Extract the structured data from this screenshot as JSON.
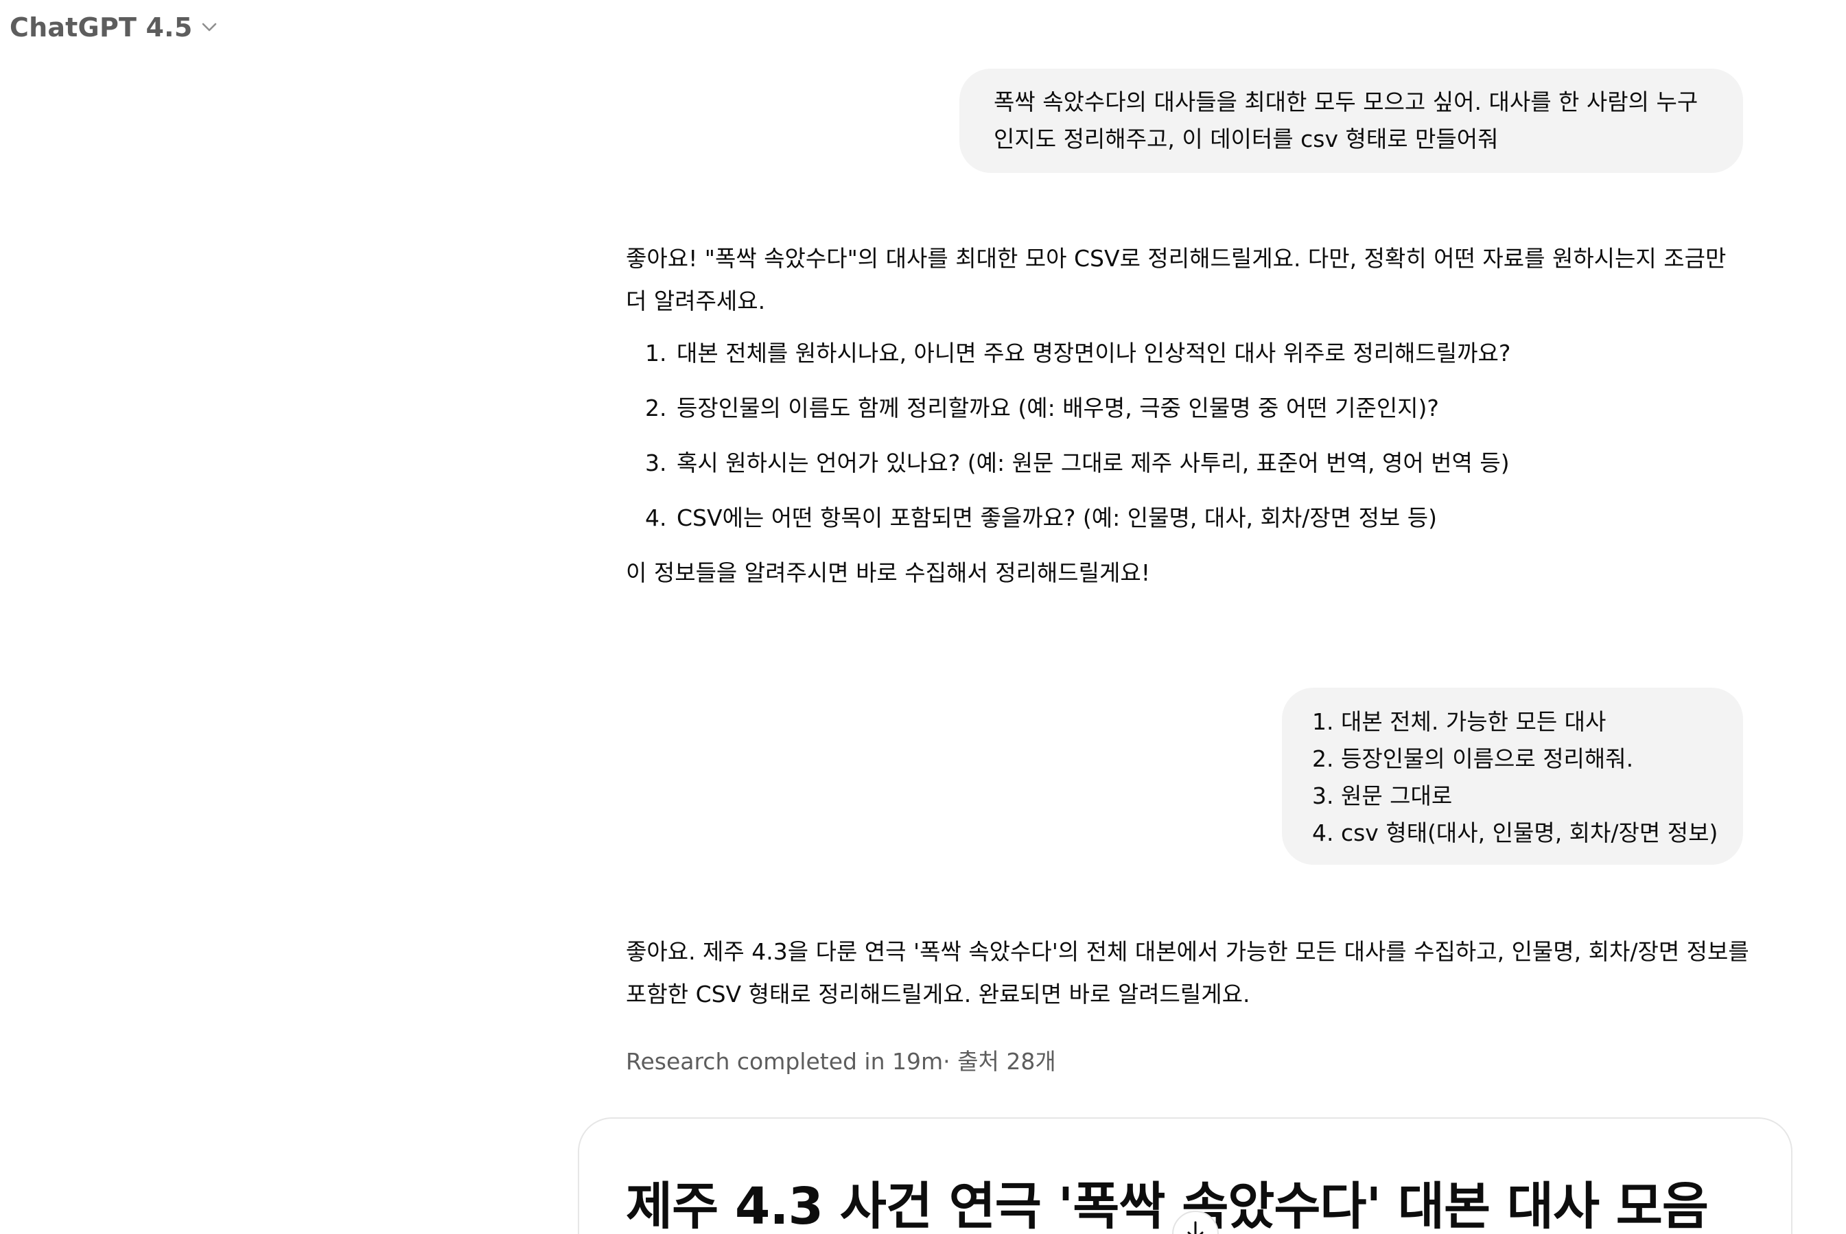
{
  "header": {
    "model_label": "ChatGPT 4.5",
    "model_dropdown_icon": "chevron-down-icon"
  },
  "conversation": {
    "user_message_1": {
      "lines": [
        "폭싹 속았수다의 대사들을 최대한 모두 모으고 싶어. 대사를 한 사람의 누구",
        "인지도 정리해주고,  이 데이터를 csv 형태로 만들어줘"
      ]
    },
    "assistant_message_1": {
      "intro": "좋아요! \"폭싹 속았수다\"의 대사를 최대한 모아 CSV로 정리해드릴게요. 다만, 정확히 어떤 자료를 원하시는지 조금만 더 알려주세요.",
      "questions": [
        "대본 전체를 원하시나요, 아니면 주요 명장면이나 인상적인 대사 위주로 정리해드릴까요?",
        "등장인물의 이름도 함께 정리할까요 (예: 배우명, 극중 인물명 중 어떤 기준인지)?",
        "혹시 원하시는 언어가 있나요? (예: 원문 그대로 제주 사투리, 표준어 번역, 영어 번역 등)",
        "CSV에는 어떤 항목이 포함되면 좋을까요? (예: 인물명, 대사, 회차/장면 정보 등)"
      ],
      "closing": "이 정보들을 알려주시면 바로 수집해서 정리해드릴게요!"
    },
    "user_message_2": {
      "lines": [
        "1. 대본 전체. 가능한 모든 대사",
        "2. 등장인물의 이름으로 정리해줘.",
        "3. 원문 그대로",
        "4. csv 형태(대사, 인물명, 회차/장면 정보)"
      ]
    },
    "assistant_message_2": {
      "text": "좋아요. 제주 4.3을 다룬 연극 '폭싹 속았수다'의 전체 대본에서 가능한 모든 대사를 수집하고, 인물명, 회차/장면 정보를 포함한 CSV 형태로 정리해드릴게요. 완료되면 바로 알려드릴게요."
    },
    "research_status": "Research completed in 19m· 출처 28개",
    "report": {
      "title": "제주 4.3 사건 연극 '폭싹 속았수다' 대본 대사 모음"
    },
    "scroll_button_icon": "arrow-down-icon"
  }
}
